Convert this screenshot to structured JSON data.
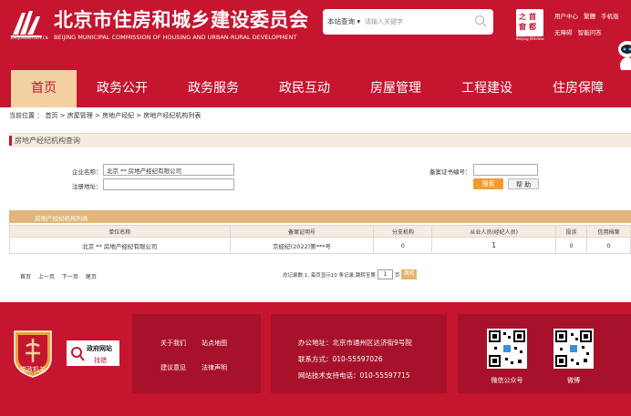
{
  "header": {
    "site_title": "北京市住房和城乡建设委员会",
    "site_title_en": "BEIJING MUNICIPAL COMMISSION OF HOUSING AND URBAN-RURAL DEVELOPMENT",
    "logo_text": "ZHUJIANWEI.GOV.CN",
    "search_scope": "本站查询",
    "search_placeholder": "请输入关键字",
    "capital_chars": [
      "首",
      "之",
      "都",
      "窗"
    ],
    "capital_caption": "Beijing Window",
    "links_row1": [
      "用户中心",
      "繁體",
      "手机版"
    ],
    "links_row2": [
      "无障碍",
      "智能问答"
    ]
  },
  "nav": {
    "items": [
      "首页",
      "政务公开",
      "政务服务",
      "政民互动",
      "房屋管理",
      "工程建设",
      "住房保障"
    ],
    "active_index": 0
  },
  "breadcrumb": "当前位置 ： 首页 > 房屋管理 > 房地产经纪 > 房地产经纪机构列表",
  "query": {
    "section_title": "房地产经纪机构查询",
    "company_label": "企业名称：",
    "company_value": "北京 ** 房地产经纪有限公司",
    "address_label": "注册地址：",
    "address_value": "",
    "cert_label": "备案证书编号：",
    "cert_value": "",
    "search_button": "搜索",
    "help_button": "帮 助"
  },
  "results": {
    "section_title": "房地产经纪机构列表",
    "columns": [
      "单位名称",
      "备案证明号",
      "分支机构",
      "从业人员(经纪人员)",
      "投诉",
      "信用档案"
    ],
    "rows": [
      [
        "北京 ** 房地产经纪有限公司",
        "京经纪(2022)第***号",
        "0",
        "1",
        "0",
        "0"
      ]
    ]
  },
  "pagination": {
    "links": [
      "首页",
      "上一页",
      "下一页",
      "尾页"
    ],
    "info_text": "总记录数:1, 每页显示10 条记录,跳转至第",
    "page_value": "1",
    "page_suffix": "页",
    "go_button": "跳转"
  },
  "footer": {
    "party_badge": "党政机关",
    "gov_badge_title": "政府网站",
    "gov_badge_action": "找错",
    "links": [
      "关于我们",
      "站点地图",
      "建议意见",
      "法律声明"
    ],
    "address": "办公地址：北京市通州区达济街9号院",
    "phone": "联系方式：010-55597026",
    "support": "网站技术支持电话：010-55597715",
    "qr_labels": [
      "微信公众号",
      "微博"
    ]
  },
  "colors": {
    "brand_red": "#c5152f",
    "nav_active_bg": "#f3d1a2",
    "search_button": "#f29a2e"
  }
}
